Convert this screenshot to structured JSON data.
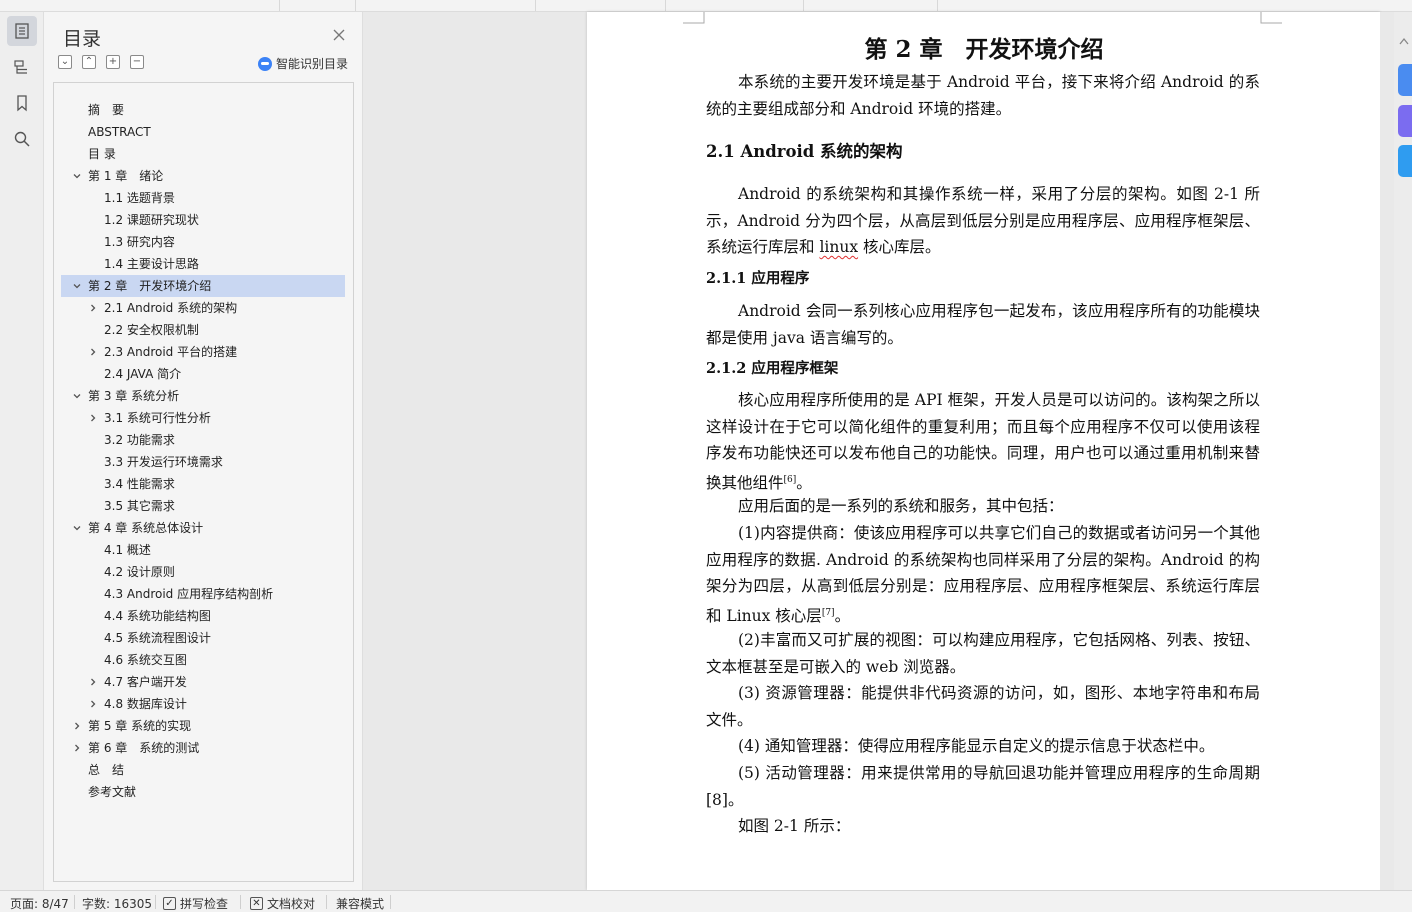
{
  "toc": {
    "title": "目录",
    "smart_label": "智能识别目录",
    "tools": [
      "⌄",
      "⌃",
      "+",
      "−"
    ],
    "items": [
      {
        "label": "摘　要",
        "level": 0,
        "arrow": ""
      },
      {
        "label": "ABSTRACT",
        "level": 0,
        "arrow": ""
      },
      {
        "label": "目 录",
        "level": 0,
        "arrow": ""
      },
      {
        "label": "第 1 章　绪论",
        "level": 0,
        "arrow": "down"
      },
      {
        "label": "1.1  选题背景",
        "level": 1,
        "arrow": ""
      },
      {
        "label": "1.2  课题研究现状",
        "level": 1,
        "arrow": ""
      },
      {
        "label": "1.3  研究内容",
        "level": 1,
        "arrow": ""
      },
      {
        "label": "1.4  主要设计思路",
        "level": 1,
        "arrow": ""
      },
      {
        "label": "第 2 章　开发环境介绍",
        "level": 0,
        "arrow": "down",
        "selected": true
      },
      {
        "label": "2.1 Android 系统的架构",
        "level": 1,
        "arrow": "right"
      },
      {
        "label": "2.2  安全权限机制",
        "level": 1,
        "arrow": ""
      },
      {
        "label": "2.3 Android 平台的搭建",
        "level": 1,
        "arrow": "right"
      },
      {
        "label": "2.4 JAVA 简介",
        "level": 1,
        "arrow": ""
      },
      {
        "label": "第 3 章  系统分析",
        "level": 0,
        "arrow": "down"
      },
      {
        "label": "3.1  系统可行性分析",
        "level": 1,
        "arrow": "right"
      },
      {
        "label": "3.2  功能需求",
        "level": 1,
        "arrow": ""
      },
      {
        "label": "3.3  开发运行环境需求",
        "level": 1,
        "arrow": ""
      },
      {
        "label": "3.4  性能需求",
        "level": 1,
        "arrow": ""
      },
      {
        "label": "3.5  其它需求",
        "level": 1,
        "arrow": ""
      },
      {
        "label": "第 4 章  系统总体设计",
        "level": 0,
        "arrow": "down"
      },
      {
        "label": "4.1  概述",
        "level": 1,
        "arrow": ""
      },
      {
        "label": "4.2  设计原则",
        "level": 1,
        "arrow": ""
      },
      {
        "label": "4.3 Android 应用程序结构剖析",
        "level": 1,
        "arrow": ""
      },
      {
        "label": "4.4  系统功能结构图",
        "level": 1,
        "arrow": ""
      },
      {
        "label": "4.5  系统流程图设计",
        "level": 1,
        "arrow": ""
      },
      {
        "label": "4.6  系统交互图",
        "level": 1,
        "arrow": ""
      },
      {
        "label": "4.7  客户端开发",
        "level": 1,
        "arrow": "right"
      },
      {
        "label": "4.8  数据库设计",
        "level": 1,
        "arrow": "right"
      },
      {
        "label": "第 5 章  系统的实现",
        "level": 0,
        "arrow": "right"
      },
      {
        "label": "第 6 章　系统的测试",
        "level": 0,
        "arrow": "right"
      },
      {
        "label": "总　结",
        "level": 0,
        "arrow": ""
      },
      {
        "label": "参考文献",
        "level": 0,
        "arrow": ""
      }
    ]
  },
  "document": {
    "chapter_title": "第 2 章　开发环境介绍",
    "intro": "本系统的主要开发环境是基于 Android 平台，接下来将介绍 Android 的系统的主要组成部分和 Android 环境的搭建。",
    "h2_1": "2.1 Android 系统的架构",
    "p_arch_a": "Android 的系统架构和其操作系统一样，采用了分层的架构。如图 2-1 所示，Android 分为四个层，从高层到低层分别是应用程序层、应用程序框架层、系统运行库层和 ",
    "p_arch_linux": "linux",
    "p_arch_b": " 核心库层。",
    "h3_1": "2.1.1  应用程序",
    "p_app": "Android 会同一系列核心应用程序包一起发布，该应用程序所有的功能模块都是使用 java 语言编写的。",
    "h3_2": "2.1.2  应用程序框架",
    "p_fw": "核心应用程序所使用的是 API 框架，开发人员是可以访问的。该构架之所以这样设计在于它可以简化组件的重复利用；而且每个应用程序不仅可以使用该程序发布功能快还可以发布他自己的功能快。同理，用户也可以通过重用机制来替换其他组件",
    "ref6": "[6]",
    "p_fw_end": "。",
    "p_services": "应用后面的是一系列的系统和服务，其中包括：",
    "p_1": "(1)内容提供商：使该应用程序可以共享它们自己的数据或者访问另一个其他应用程序的数据. Android 的系统架构也同样采用了分层的架构。Android 的构架分为四层，从高到低层分别是：应用程序层、应用程序框架层、系统运行库层和 Linux 核心层",
    "ref7": "[7]",
    "p_1_end": "。",
    "p_2": "(2)丰富而又可扩展的视图：可以构建应用程序，它包括网格、列表、按钮、文本框甚至是可嵌入的 web 浏览器。",
    "p_3": "(3)  资源管理器：能提供非代码资源的访问，如，图形、本地字符串和布局文件。",
    "p_4": "(4)  通知管理器：使得应用程序能显示自定义的提示信息于状态栏中。",
    "p_5": "(5)  活动管理器：用来提供常用的导航回退功能并管理应用程序的生命周期[8]。",
    "p_fig": "如图 2-1 所示："
  },
  "status": {
    "page": "页面: 8/47",
    "words": "字数: 16305",
    "spell": "拼写检查",
    "proof": "文档校对",
    "compat": "兼容模式"
  },
  "colors": {
    "accent": "#3b82f6",
    "selection": "#c9d7f2",
    "tab1": "#4a8cf0",
    "tab2": "#7b6cf0",
    "tab3": "#2f9cf0"
  },
  "icons": [
    "document-outline-icon",
    "navigation-icon",
    "bookmark-icon",
    "search-icon",
    "close-icon",
    "smart-toc-icon"
  ]
}
